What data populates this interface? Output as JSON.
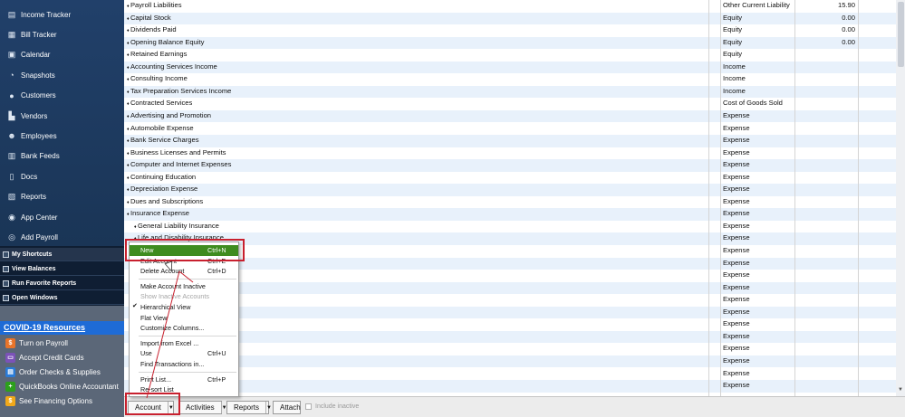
{
  "sidebar": {
    "nav": [
      {
        "label": "Income Tracker",
        "icon": "income-tracker-icon",
        "glyph": "▤"
      },
      {
        "label": "Bill Tracker",
        "icon": "bill-tracker-icon",
        "glyph": "▦"
      },
      {
        "label": "Calendar",
        "icon": "calendar-icon",
        "glyph": "▣"
      },
      {
        "label": "Snapshots",
        "icon": "snapshots-icon",
        "glyph": "◔"
      },
      {
        "label": "Customers",
        "icon": "customers-icon",
        "glyph": "●"
      },
      {
        "label": "Vendors",
        "icon": "vendors-icon",
        "glyph": "▙"
      },
      {
        "label": "Employees",
        "icon": "employees-icon",
        "glyph": "☻"
      },
      {
        "label": "Bank Feeds",
        "icon": "bank-feeds-icon",
        "glyph": "▥"
      },
      {
        "label": "Docs",
        "icon": "docs-icon",
        "glyph": "▯"
      },
      {
        "label": "Reports",
        "icon": "reports-icon",
        "glyph": "▧"
      },
      {
        "label": "App Center",
        "icon": "app-center-icon",
        "glyph": "◉"
      },
      {
        "label": "Add Payroll",
        "icon": "add-payroll-icon",
        "glyph": "◎"
      }
    ],
    "shortcuts": [
      {
        "label": "My Shortcuts"
      },
      {
        "label": "View Balances"
      },
      {
        "label": "Run Favorite Reports"
      },
      {
        "label": "Open Windows"
      }
    ],
    "covid": {
      "title": "COVID-19 Resources",
      "items": [
        {
          "label": "Turn on Payroll",
          "icon": "payroll-icon",
          "color": "#e8742a",
          "glyph": "$"
        },
        {
          "label": "Accept Credit Cards",
          "icon": "credit-card-icon",
          "color": "#7b52b8",
          "glyph": "▭"
        },
        {
          "label": "Order Checks & Supplies",
          "icon": "checks-icon",
          "color": "#2a7bd6",
          "glyph": "▤"
        },
        {
          "label": "QuickBooks Online Accountant",
          "icon": "qbo-accountant-icon",
          "color": "#2ca01c",
          "glyph": "+"
        },
        {
          "label": "See Financing Options",
          "icon": "financing-icon",
          "color": "#f0a81a",
          "glyph": "$"
        }
      ]
    }
  },
  "accounts": [
    {
      "name": "Payroll Liabilities",
      "type": "Other Current Liability",
      "balance": "15.90"
    },
    {
      "name": "Capital Stock",
      "type": "Equity",
      "balance": "0.00"
    },
    {
      "name": "Dividends Paid",
      "type": "Equity",
      "balance": "0.00"
    },
    {
      "name": "Opening Balance Equity",
      "type": "Equity",
      "balance": "0.00"
    },
    {
      "name": "Retained Earnings",
      "type": "Equity",
      "balance": ""
    },
    {
      "name": "Accounting Services Income",
      "type": "Income",
      "balance": ""
    },
    {
      "name": "Consulting Income",
      "type": "Income",
      "balance": ""
    },
    {
      "name": "Tax Preparation Services Income",
      "type": "Income",
      "balance": ""
    },
    {
      "name": "Contracted Services",
      "type": "Cost of Goods Sold",
      "balance": ""
    },
    {
      "name": "Advertising and Promotion",
      "type": "Expense",
      "balance": ""
    },
    {
      "name": "Automobile Expense",
      "type": "Expense",
      "balance": ""
    },
    {
      "name": "Bank Service Charges",
      "type": "Expense",
      "balance": ""
    },
    {
      "name": "Business Licenses and Permits",
      "type": "Expense",
      "balance": ""
    },
    {
      "name": "Computer and Internet Expenses",
      "type": "Expense",
      "balance": ""
    },
    {
      "name": "Continuing Education",
      "type": "Expense",
      "balance": ""
    },
    {
      "name": "Depreciation Expense",
      "type": "Expense",
      "balance": ""
    },
    {
      "name": "Dues and Subscriptions",
      "type": "Expense",
      "balance": ""
    },
    {
      "name": "Insurance Expense",
      "type": "Expense",
      "balance": ""
    },
    {
      "name": "General Liability Insurance",
      "type": "Expense",
      "balance": "",
      "sub": true
    },
    {
      "name": "Life and Disability Insurance",
      "type": "Expense",
      "balance": "",
      "sub": true
    },
    {
      "name": "",
      "type": "Expense",
      "balance": ""
    },
    {
      "name": "",
      "type": "Expense",
      "balance": ""
    },
    {
      "name": "",
      "type": "Expense",
      "balance": ""
    },
    {
      "name": "",
      "type": "Expense",
      "balance": ""
    },
    {
      "name": "",
      "type": "Expense",
      "balance": ""
    },
    {
      "name": "",
      "type": "Expense",
      "balance": ""
    },
    {
      "name": "",
      "type": "Expense",
      "balance": ""
    },
    {
      "name": "",
      "type": "Expense",
      "balance": ""
    },
    {
      "name": "",
      "type": "Expense",
      "balance": ""
    },
    {
      "name": "",
      "type": "Expense",
      "balance": ""
    },
    {
      "name": "",
      "type": "Expense",
      "balance": ""
    },
    {
      "name": "",
      "type": "Expense",
      "balance": ""
    }
  ],
  "menu": {
    "items": [
      {
        "label": "New",
        "shortcut": "Ctrl+N",
        "highlight": true
      },
      {
        "label": "Edit Account",
        "shortcut": "Ctrl+E"
      },
      {
        "label": "Delete Account",
        "shortcut": "Ctrl+D"
      },
      {
        "sep": true
      },
      {
        "label": "Make Account Inactive",
        "shortcut": ""
      },
      {
        "label": "Show Inactive Accounts",
        "shortcut": "",
        "disabled": true
      },
      {
        "label": "Hierarchical View",
        "shortcut": "",
        "checked": true
      },
      {
        "label": "Flat View",
        "shortcut": ""
      },
      {
        "label": "Customize Columns...",
        "shortcut": ""
      },
      {
        "sep": true
      },
      {
        "label": "Import from Excel ...",
        "shortcut": ""
      },
      {
        "label": "Use",
        "shortcut": "Ctrl+U"
      },
      {
        "label": "Find Transactions in...",
        "shortcut": ""
      },
      {
        "sep": true
      },
      {
        "label": "Print List...",
        "shortcut": "Ctrl+P"
      },
      {
        "label": "Re-sort List",
        "shortcut": ""
      }
    ]
  },
  "toolbar": {
    "account_label": "Account",
    "activities_label": "Activities",
    "reports_label": "Reports",
    "attach_label": "Attach",
    "include_inactive_label": "Include inactive"
  },
  "colors": {
    "sidebar": "#1f3a5c",
    "row_alt": "#e8f1fb",
    "menu_highlight": "#3e8c1f",
    "annotation": "#c8202e",
    "covid_header": "#1e6bd6"
  }
}
